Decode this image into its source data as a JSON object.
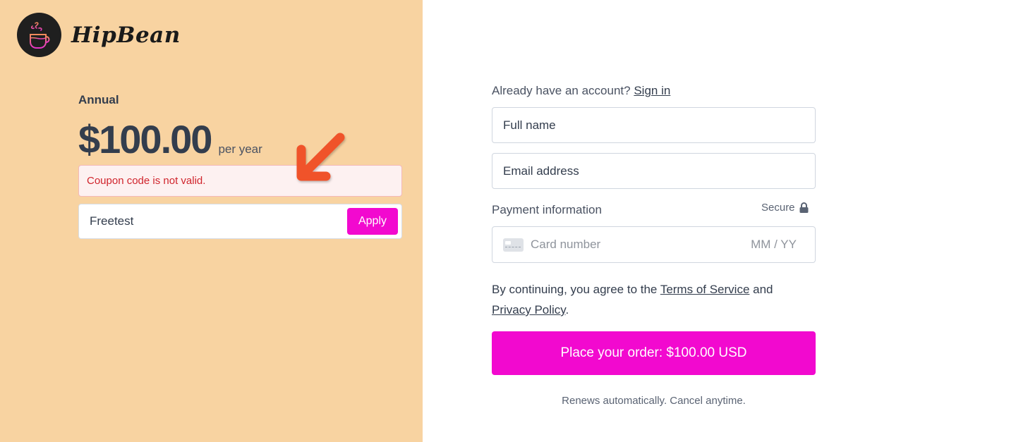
{
  "brand": {
    "name": "HipBean",
    "logo_icon": "coffee-cup-icon"
  },
  "plan": {
    "label": "Annual",
    "price": "$100.00",
    "period": "per year"
  },
  "coupon": {
    "error": "Coupon code is not valid.",
    "value": "Freetest",
    "apply_label": "Apply"
  },
  "annotation": {
    "arrow_icon": "arrow-down-left-icon",
    "color": "#f0532b"
  },
  "account": {
    "prompt": "Already have an account?",
    "signin_label": "Sign in"
  },
  "form": {
    "full_name_placeholder": "Full name",
    "email_placeholder": "Email address",
    "payment_label": "Payment information",
    "secure_label": "Secure",
    "card_placeholder": "Card number",
    "expiry_placeholder": "MM / YY"
  },
  "terms": {
    "prefix": "By continuing, you agree to the",
    "tos_label": "Terms of Service",
    "and": "and",
    "privacy_label": "Privacy Policy",
    "suffix": "."
  },
  "order": {
    "button_label": "Place your order: $100.00 USD",
    "renew_note": "Renews automatically. Cancel anytime."
  },
  "colors": {
    "left_bg": "#f8d3a1",
    "accent": "#f209cf",
    "error": "#d0242c",
    "text": "#333d4d"
  }
}
